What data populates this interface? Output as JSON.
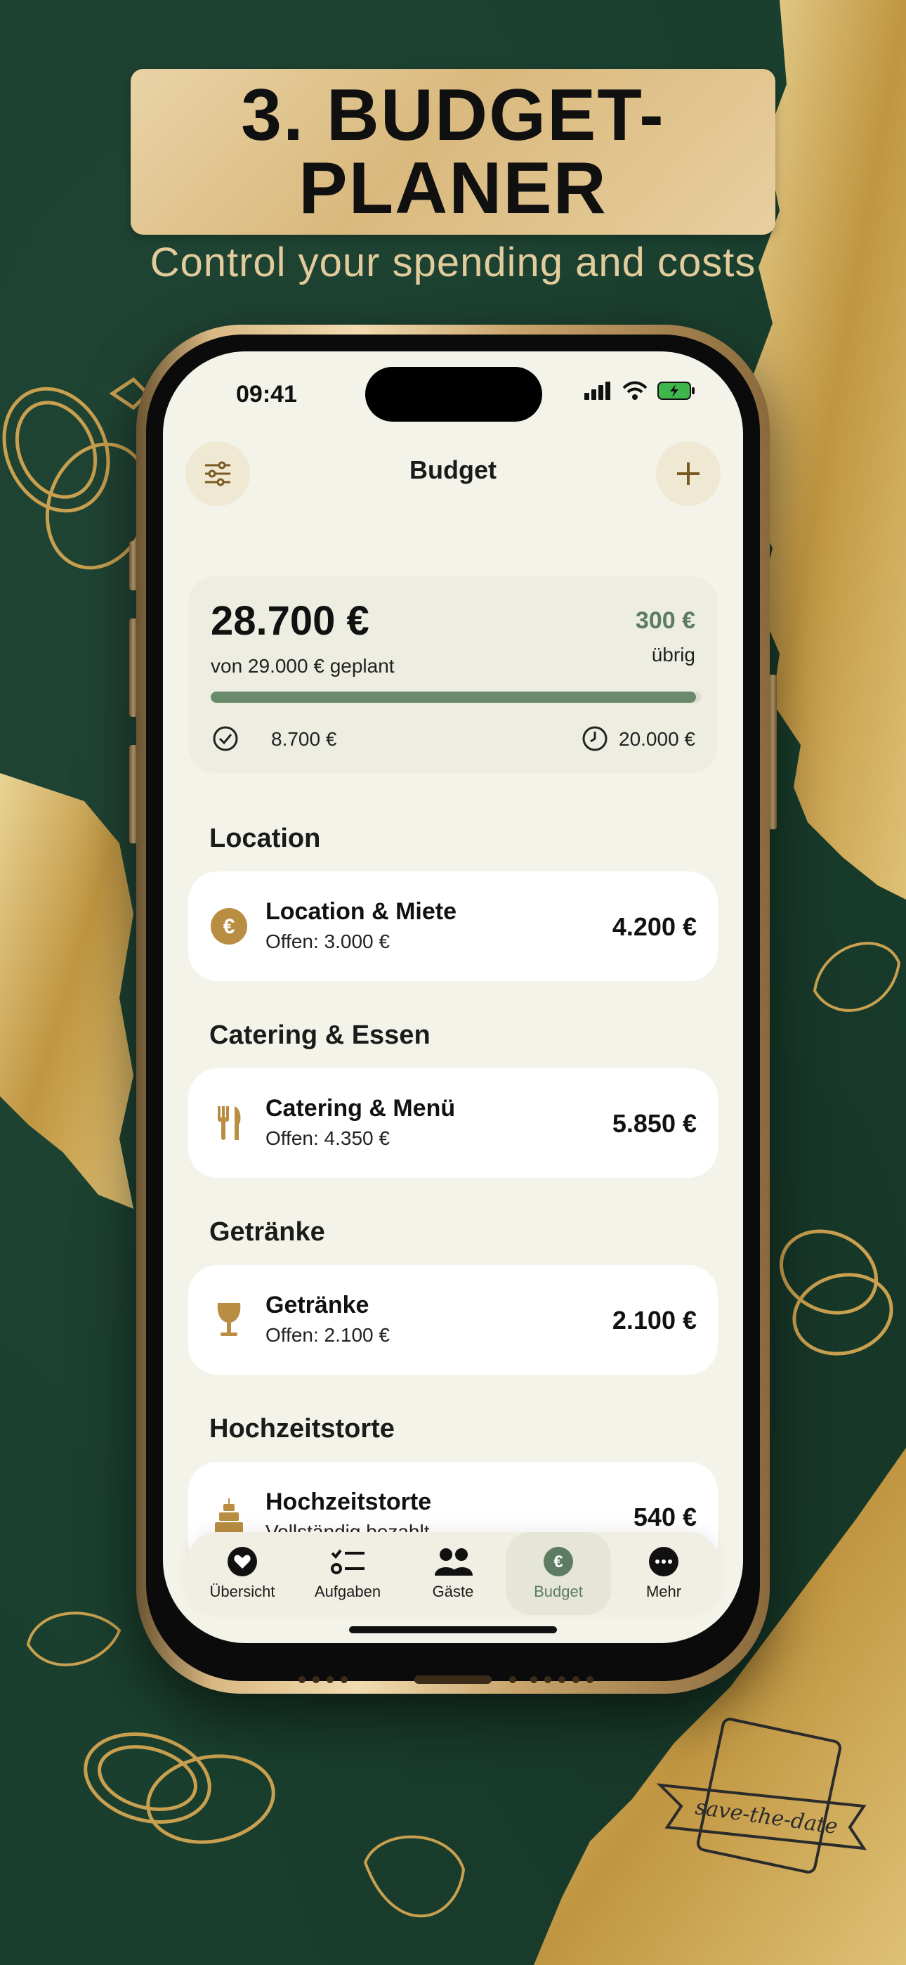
{
  "banner": {
    "title_line1": "3. BUDGET-",
    "title_line2": "PLANER",
    "subtitle": "Control your spending and costs"
  },
  "status_bar": {
    "time": "09:41"
  },
  "nav": {
    "title": "Budget",
    "filter_icon": "sliders-icon",
    "add_icon": "plus-icon"
  },
  "summary": {
    "total": "28.700 €",
    "planned": "von 29.000 € geplant",
    "remaining": "300 €",
    "remaining_label": "übrig",
    "progress": 0.99,
    "paid": "8.700 €",
    "open": "20.000 €"
  },
  "sections": [
    {
      "title": "Location",
      "item": {
        "name": "Location & Miete",
        "sub": "Offen: 3.000 €",
        "amount": "4.200 €",
        "icon": "euro-icon"
      }
    },
    {
      "title": "Catering & Essen",
      "item": {
        "name": "Catering & Menü",
        "sub": "Offen: 4.350 €",
        "amount": "5.850 €",
        "icon": "cutlery-icon"
      }
    },
    {
      "title": "Getränke",
      "item": {
        "name": "Getränke",
        "sub": "Offen: 2.100 €",
        "amount": "2.100 €",
        "icon": "wine-glass-icon"
      }
    },
    {
      "title": "Hochzeitstorte",
      "item": {
        "name": "Hochzeitstorte",
        "sub": "Vollständig bezahlt",
        "amount": "540 €",
        "icon": "cake-icon"
      }
    }
  ],
  "tabs": [
    {
      "label": "Übersicht",
      "icon": "heart-icon"
    },
    {
      "label": "Aufgaben",
      "icon": "tasks-icon"
    },
    {
      "label": "Gäste",
      "icon": "guests-icon"
    },
    {
      "label": "Budget",
      "icon": "euro-icon",
      "active": true
    },
    {
      "label": "Mehr",
      "icon": "more-icon"
    }
  ],
  "colors": {
    "background": "#1a3f2e",
    "gold": "#c9a04f",
    "accent_green": "#5d7c62",
    "screen_bg": "#f4f3ea"
  },
  "decoration": {
    "stamp_text": "save-the-date"
  }
}
